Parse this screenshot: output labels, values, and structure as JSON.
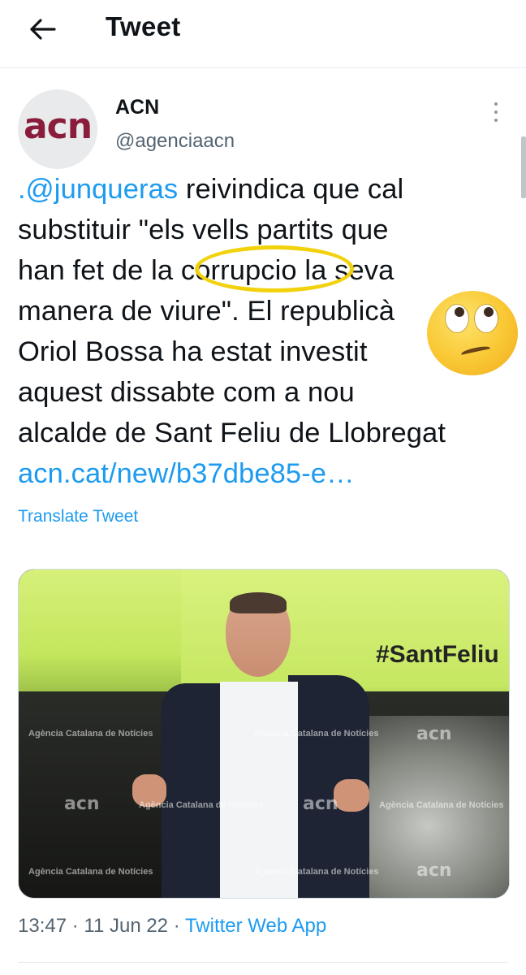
{
  "header": {
    "title": "Tweet",
    "back_icon": "arrow-left-icon"
  },
  "author": {
    "name": "ACN",
    "handle": "@agenciaacn",
    "avatar_text": "acn"
  },
  "tweet": {
    "lines": [
      {
        "mention": ".@junqueras",
        "rest": " reivindica que cal"
      },
      {
        "text": "substituir \"els vells partits que"
      },
      {
        "before": "han fet de la ",
        "highlighted": "corrupcio",
        "after": " la seva"
      },
      {
        "text": "manera de viure\". El republicà"
      },
      {
        "text": "Oriol Bossa ha estat investit"
      },
      {
        "text": "aquest dissabte com a nou"
      },
      {
        "text": "alcalde de Sant Feliu de Llobregat"
      }
    ],
    "link": "acn.cat/new/b37dbe85-e…",
    "translate": "Translate Tweet"
  },
  "media": {
    "hashtag": "#SantFeliu",
    "watermark": "Agència Catalana de Notícies",
    "watermark_logo": "acn"
  },
  "meta": {
    "time": "13:47",
    "date": "11 Jun 22",
    "sep": " · ",
    "app": "Twitter Web App"
  },
  "colors": {
    "link": "#1d9bf0",
    "highlight_ring": "#f2d20d",
    "logo": "#8a1d3b"
  }
}
